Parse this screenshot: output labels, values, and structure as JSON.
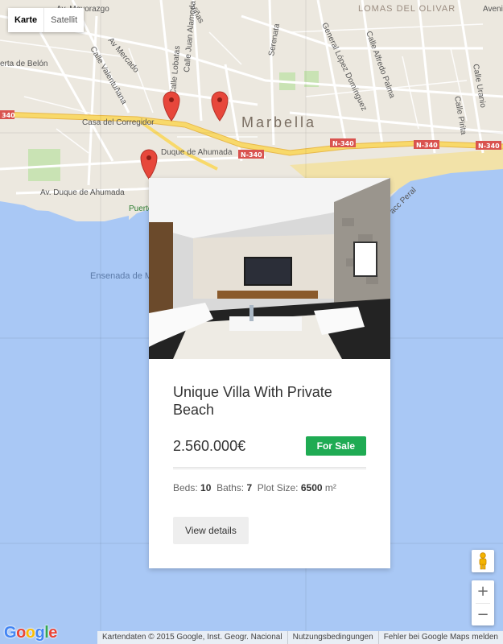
{
  "map": {
    "type_controls": {
      "map": "Karte",
      "satellite": "Satellit"
    },
    "city_label": "Marbella",
    "place_labels": [
      "Av. Mayorazgo",
      "Viñas",
      "Calle Juan Alameda",
      "Calle Lobatas",
      "Av Mercado",
      "Calle Valentuñana",
      "Serenata",
      "General López Domínguez",
      "Calle Alfredo Palma",
      "Calle Pirita",
      "Calle Uranio",
      "LOMAS DEL OLIVAR",
      "Avenida",
      "erta de Belón",
      "Casa del Corregidor",
      "Duque de Ahumada",
      "Av. Duque de Ahumada",
      "Puerto de Marbella",
      "Ensenada de Marbella",
      "acc Peral"
    ],
    "road_shields": [
      "N-340",
      "N-340",
      "N-340",
      "N-340",
      "340"
    ],
    "markers": [
      "marker-1",
      "marker-2",
      "marker-3"
    ],
    "zoom_in": "+",
    "zoom_out": "−",
    "logo": "Google",
    "attribution": [
      "Kartendaten © 2015 Google, Inst. Geogr. Nacional",
      "Nutzungsbedingungen",
      "Fehler bei Google Maps melden"
    ]
  },
  "colors": {
    "water": "#a9c8f5",
    "land": "#ece8df",
    "highway": "#f8d96a",
    "badge": "#1fab53",
    "marker": "#e7473b"
  },
  "listing": {
    "title": "Unique Villa With Private Beach",
    "price": "2.560.000€",
    "status": "For Sale",
    "beds_label": "Beds:",
    "beds": "10",
    "baths_label": "Baths:",
    "baths": "7",
    "plot_label": "Plot Size:",
    "plot": "6500",
    "plot_unit": "m²",
    "cta": "View details"
  }
}
